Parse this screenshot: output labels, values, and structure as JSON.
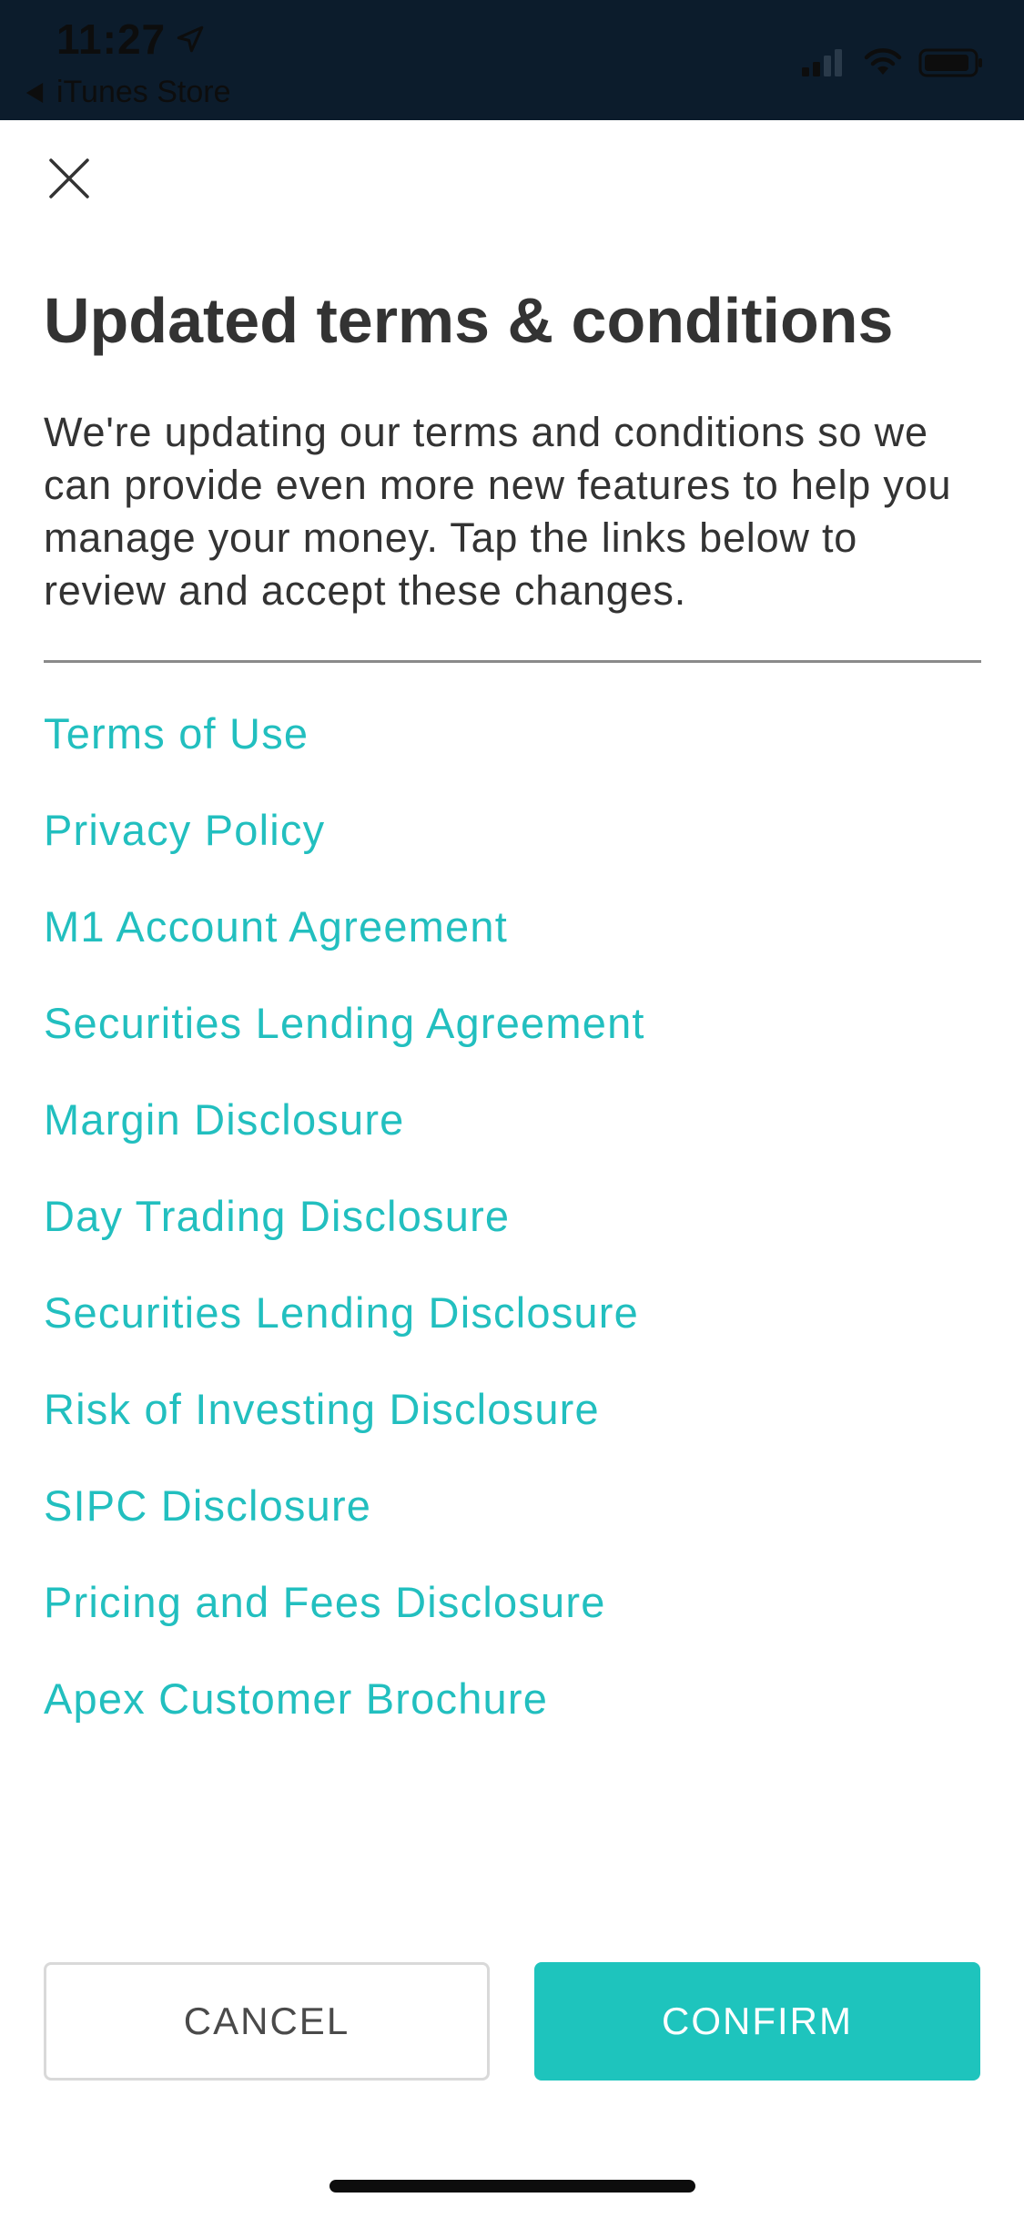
{
  "status_bar": {
    "time": "11:27",
    "back_app": "iTunes Store"
  },
  "modal": {
    "title": "Updated terms & conditions",
    "description": "We're updating our terms and conditions so we can provide even more new features to help you manage your money. Tap the links below to review and accept these changes.",
    "links": [
      "Terms of Use",
      "Privacy Policy",
      "M1 Account Agreement",
      "Securities Lending Agreement",
      "Margin Disclosure",
      "Day Trading Disclosure",
      "Securities Lending Disclosure",
      "Risk of Investing Disclosure",
      "SIPC Disclosure",
      "Pricing and Fees Disclosure",
      "Apex Customer Brochure"
    ]
  },
  "actions": {
    "cancel_label": "CANCEL",
    "confirm_label": "CONFIRM"
  },
  "colors": {
    "status_bar_bg": "#0c1c2c",
    "link": "#22bfbf",
    "confirm_bg": "#1ec4bd",
    "title_text": "#333333"
  },
  "icons": {
    "close": "close-icon",
    "location": "location-arrow-icon",
    "back": "back-arrow-icon",
    "signal": "cellular-signal-icon",
    "wifi": "wifi-icon",
    "battery": "battery-icon"
  }
}
